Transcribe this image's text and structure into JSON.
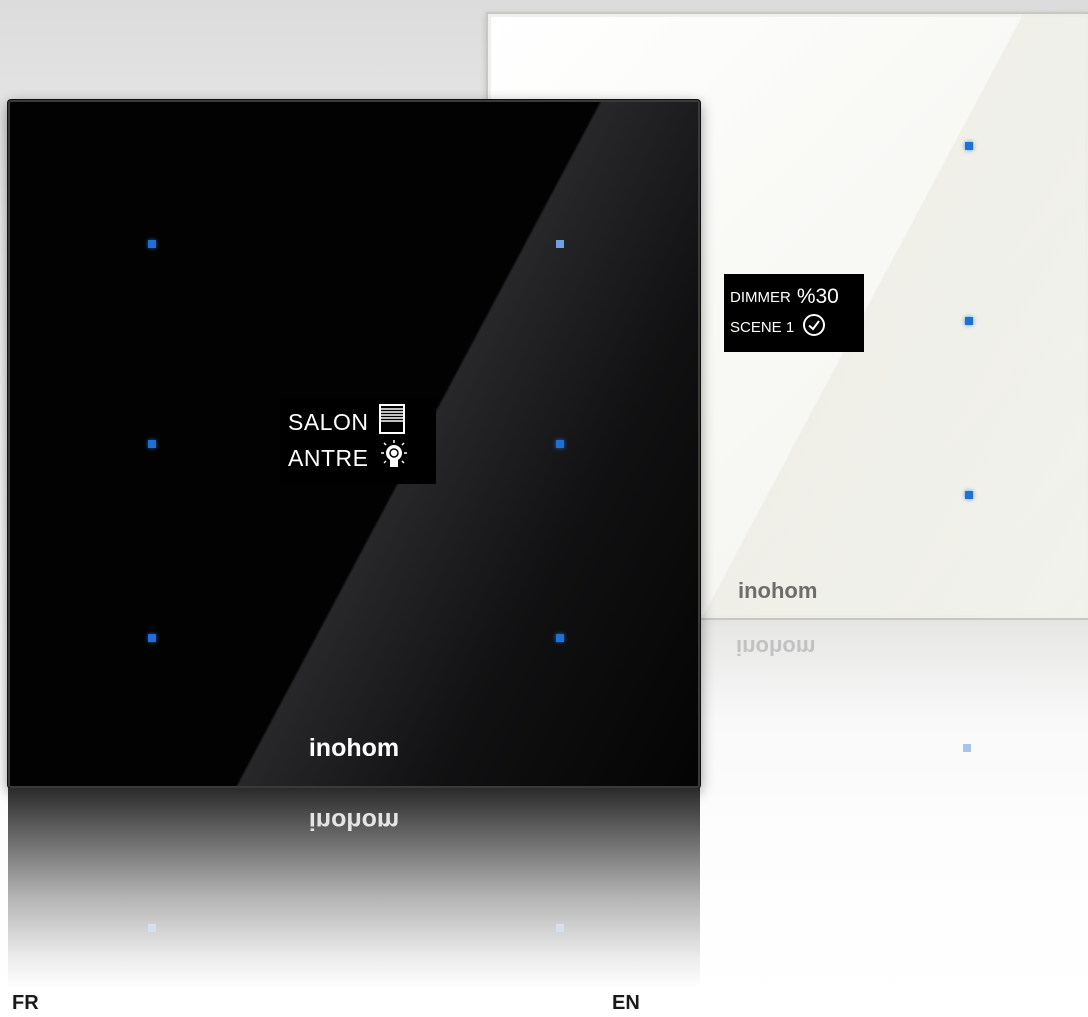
{
  "colors": {
    "led_blue": "#1f6fd6",
    "black_panel": "#020202",
    "white_panel": "#f7f7f3",
    "display_background": "#000000",
    "display_text": "#ffffff"
  },
  "fr_panel": {
    "brand": "inohom",
    "display": {
      "line1": {
        "label": "SALON",
        "icon": "window-blind-icon"
      },
      "line2": {
        "label": "ANTRE",
        "icon": "light-bulb-icon"
      }
    },
    "led_count": 6,
    "language_label": "FR"
  },
  "en_panel": {
    "brand": "inohom",
    "display": {
      "line1": {
        "label": "DIMMER",
        "value": "%30"
      },
      "line2": {
        "label": "SCENE 1",
        "icon": "clock-check-icon"
      }
    },
    "led_count": 3,
    "language_label": "EN"
  }
}
